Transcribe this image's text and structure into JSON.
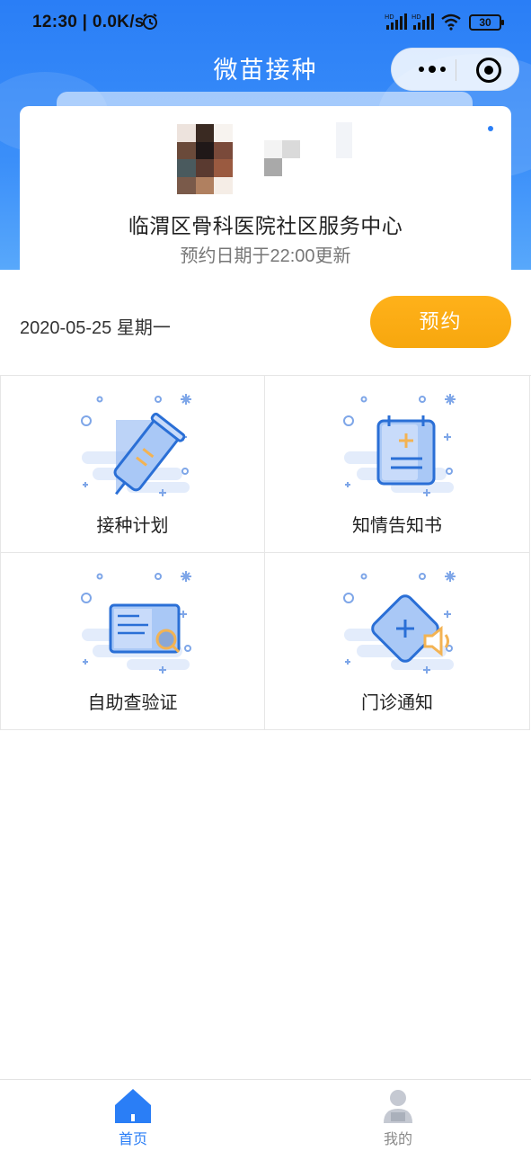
{
  "status_bar": {
    "time": "12:30 | 0.0K/s",
    "battery": "30"
  },
  "nav": {
    "title": "微苗接种"
  },
  "card": {
    "org_name": "临渭区骨科医院社区服务中心",
    "update_note": "预约日期于22:00更新"
  },
  "booking": {
    "date": "2020-05-25 星期一",
    "button_label": "预约"
  },
  "grid": {
    "items": [
      {
        "label": "接种计划",
        "icon": "syringe-icon"
      },
      {
        "label": "知情告知书",
        "icon": "notebook-icon"
      },
      {
        "label": "自助查验证",
        "icon": "certificate-search-icon"
      },
      {
        "label": "门诊通知",
        "icon": "speaker-notice-icon"
      }
    ]
  },
  "tabbar": {
    "items": [
      {
        "label": "首页",
        "icon": "home-icon",
        "active": true
      },
      {
        "label": "我的",
        "icon": "user-icon",
        "active": false
      }
    ]
  },
  "colors": {
    "primary": "#2a7ef6",
    "accent_orange": "#f7a70e",
    "text_dark": "#222222",
    "text_muted": "#777777"
  }
}
